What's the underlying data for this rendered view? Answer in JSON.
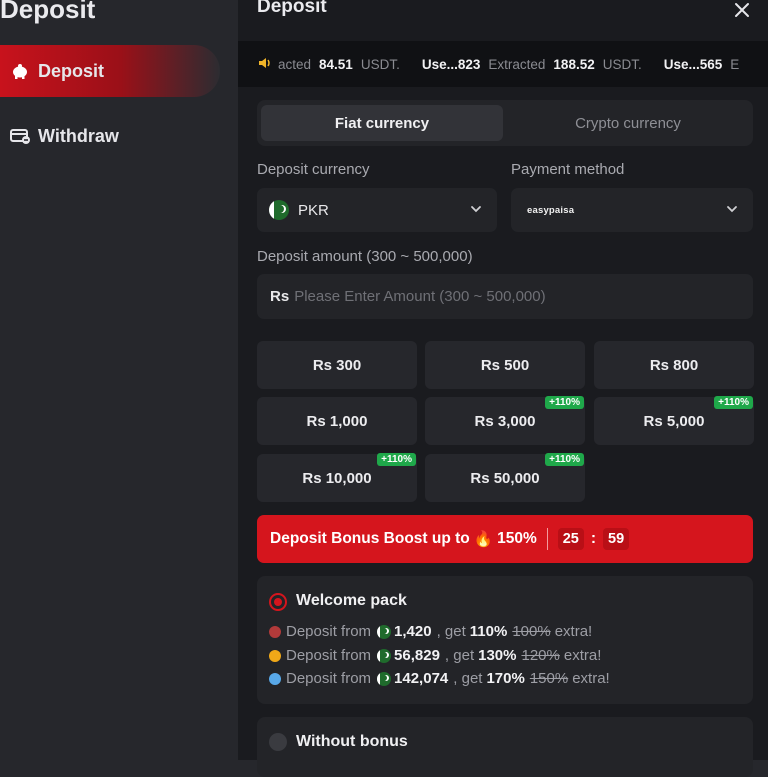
{
  "sidebar": {
    "title": "Deposit",
    "items": [
      {
        "label": "Deposit",
        "icon": "piggy-bank-icon",
        "active": true
      },
      {
        "label": "Withdraw",
        "icon": "card-withdraw-icon",
        "active": false
      }
    ]
  },
  "panel": {
    "title": "Deposit",
    "close_icon": "close-icon"
  },
  "ticker": {
    "items": [
      {
        "user": "",
        "verb": "acted",
        "amount": "84.51",
        "unit": "USDT."
      },
      {
        "user": "Use...823",
        "verb": "Extracted",
        "amount": "188.52",
        "unit": "USDT."
      },
      {
        "user": "Use...565",
        "verb": "E",
        "amount": "",
        "unit": ""
      }
    ]
  },
  "tabs": {
    "fiat": "Fiat currency",
    "crypto": "Crypto currency"
  },
  "form": {
    "currency_label": "Deposit currency",
    "currency_value": "PKR",
    "method_label": "Payment method",
    "method_value": "easypaisa",
    "amount_label": "Deposit amount (300 ~ 500,000)",
    "amount_prefix": "Rs",
    "amount_placeholder": "Please Enter Amount (300 ~ 500,000)"
  },
  "amounts": [
    {
      "label": "Rs 300",
      "badge": ""
    },
    {
      "label": "Rs 500",
      "badge": ""
    },
    {
      "label": "Rs 800",
      "badge": ""
    },
    {
      "label": "Rs 1,000",
      "badge": ""
    },
    {
      "label": "Rs 3,000",
      "badge": "+110%"
    },
    {
      "label": "Rs 5,000",
      "badge": "+110%"
    },
    {
      "label": "Rs 10,000",
      "badge": "+110%"
    },
    {
      "label": "Rs 50,000",
      "badge": "+110%"
    }
  ],
  "boost": {
    "text": "Deposit Bonus Boost up to",
    "emoji": "🔥",
    "percent": "150%",
    "minutes": "25",
    "seconds": "59",
    "colon": ":"
  },
  "welcome": {
    "title": "Welcome pack",
    "rows": [
      {
        "prefix": "Deposit from",
        "amount": "1,420",
        "get": ", get",
        "pct": "110%",
        "old": "100%",
        "suffix": "extra!",
        "dot_color": "#b23a3a"
      },
      {
        "prefix": "Deposit from",
        "amount": "56,829",
        "get": ", get",
        "pct": "130%",
        "old": "120%",
        "suffix": "extra!",
        "dot_color": "#f0a818"
      },
      {
        "prefix": "Deposit from",
        "amount": "142,074",
        "get": ", get",
        "pct": "170%",
        "old": "150%",
        "suffix": "extra!",
        "dot_color": "#58a8e8"
      }
    ]
  },
  "no_bonus": {
    "title": "Without bonus"
  },
  "colors": {
    "accent": "#d5151d",
    "badge": "#1fa84a",
    "panel_bg": "#1a1b1f",
    "card_bg": "#232428"
  }
}
